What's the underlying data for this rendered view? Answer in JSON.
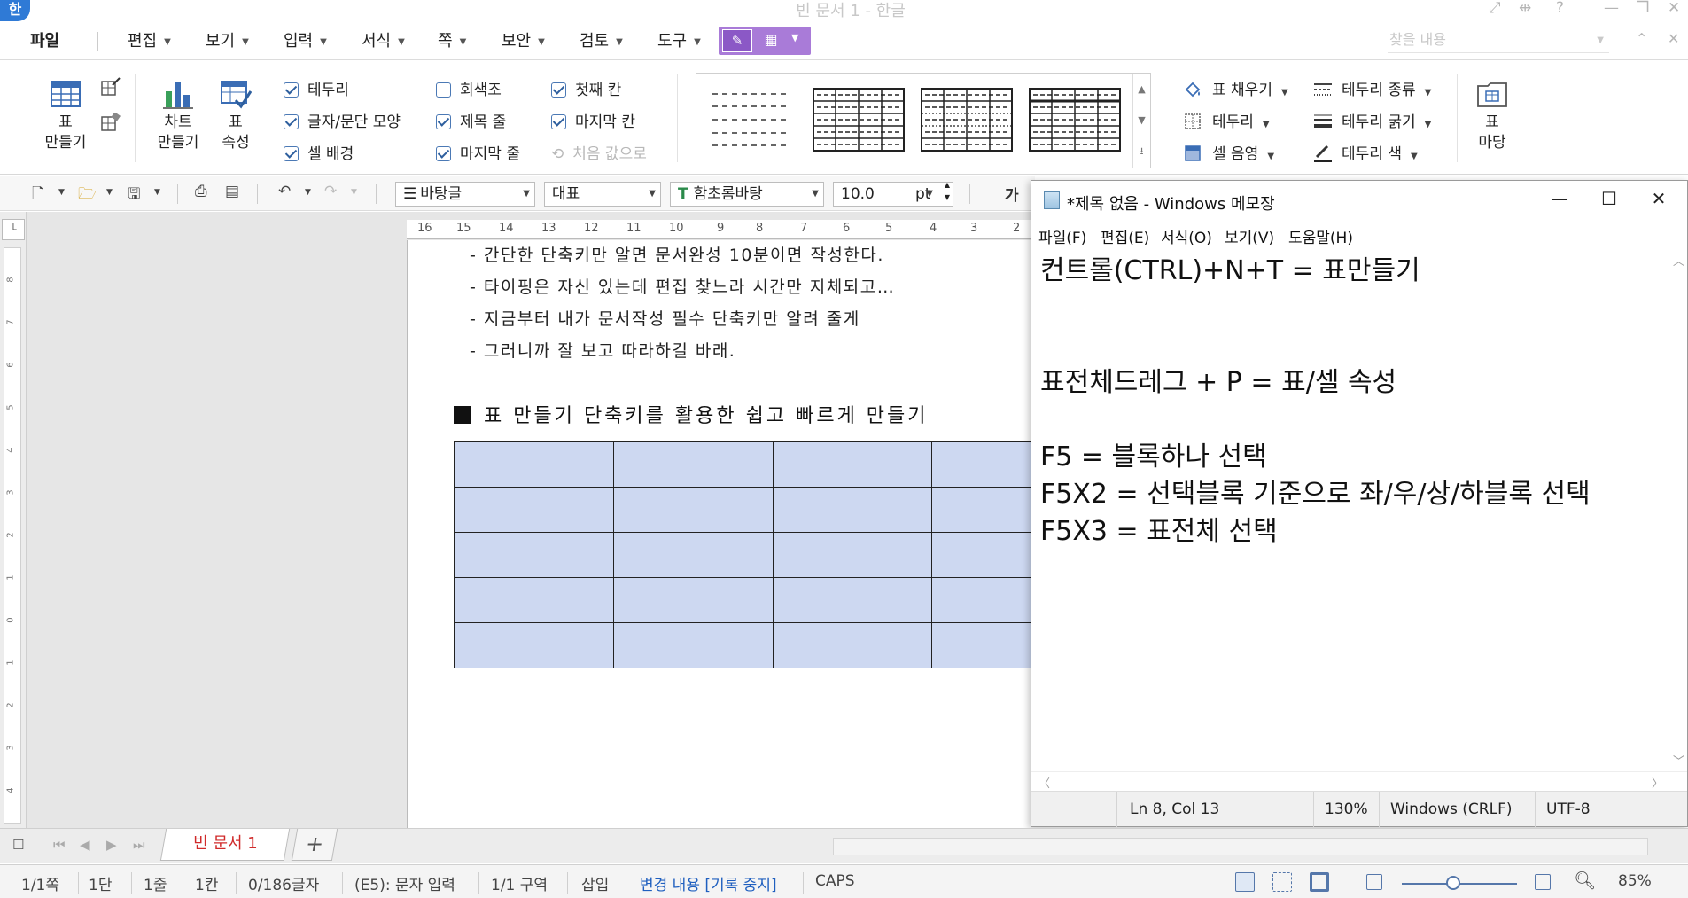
{
  "app": {
    "logo": "한",
    "window_title": "빈 문서 1 - 한글"
  },
  "menu": {
    "items": [
      "파일",
      "편집",
      "보기",
      "입력",
      "서식",
      "쪽",
      "보안",
      "검토",
      "도구"
    ],
    "find_placeholder": "찾을 내용"
  },
  "ribbon": {
    "make_table": "표\n만들기",
    "chart": "차트\n만들기",
    "table_props": "표\n속성",
    "checks": [
      {
        "label": "테두리",
        "checked": true
      },
      {
        "label": "글자/문단 모양",
        "checked": true
      },
      {
        "label": "셀 배경",
        "checked": true
      },
      {
        "label": "회색조",
        "checked": false
      },
      {
        "label": "제목 줄",
        "checked": true
      },
      {
        "label": "마지막 줄",
        "checked": true
      },
      {
        "label": "첫째 칸",
        "checked": true
      },
      {
        "label": "마지막 칸",
        "checked": true
      },
      {
        "label": "처음 값으로",
        "checked": false,
        "disabled": true
      }
    ],
    "fill": "표 채우기",
    "border": "테두리",
    "cell_shade": "셀 음영",
    "border_type": "테두리 종류",
    "border_weight": "테두리 굵기",
    "border_color": "테두리 색",
    "table_madang": "표\n마당"
  },
  "toolbar": {
    "style_combo": "바탕글",
    "lang_combo": "대표",
    "font_combo": "함초롬바탕",
    "size_value": "10.0",
    "size_unit": "pt",
    "font_preview": "가"
  },
  "ruler_marks": [
    "16",
    "15",
    "14",
    "13",
    "12",
    "11",
    "10",
    "9",
    "8",
    "7",
    "6",
    "5",
    "4",
    "3",
    "2"
  ],
  "vruler_marks": [
    "8",
    "7",
    "6",
    "5",
    "4",
    "3",
    "2",
    "1",
    "0",
    "1",
    "2",
    "3",
    "4"
  ],
  "document": {
    "lines": [
      "- 간단한 단축키만 알면 문서완성 10분이면 작성한다.",
      "- 타이핑은 자신 있는데 편집 찾느라 시간만 지체되고…",
      "- 지금부터 내가 문서작성 필수 단축키만 알려 줄게",
      "- 그러니까 잘 보고 따라하길 바래."
    ],
    "heading": "표 만들기 단축키를 활용한 쉽고 빠르게 만들기",
    "table": {
      "rows": 5,
      "cols": 4
    }
  },
  "notepad": {
    "title": "*제목 없음 - Windows 메모장",
    "menu": [
      "파일(F)",
      "편집(E)",
      "서식(O)",
      "보기(V)",
      "도움말(H)"
    ],
    "lines": [
      "컨트롤(CTRL)+N+T = 표만들기",
      "",
      "",
      "표전체드레그 + P = 표/셀 속성",
      "",
      "F5 = 블록하나 선택",
      "F5X2 = 선택블록 기준으로 좌/우/상/하블록 선택",
      "F5X3 = 표전체 선택"
    ],
    "status": {
      "position": "Ln 8, Col 13",
      "zoom": "130%",
      "eol": "Windows (CRLF)",
      "encoding": "UTF-8"
    }
  },
  "tabs": {
    "doc_tab": "빈 문서 1",
    "add": "+"
  },
  "statusbar": {
    "page": "1/1쪽",
    "column": "1단",
    "line": "1줄",
    "col": "1칸",
    "chars": "0/186글자",
    "mode": "(E5): 문자 입력",
    "section": "1/1 구역",
    "insert": "삽입",
    "track": "변경 내용 [기록 중지]",
    "caps": "CAPS",
    "zoom": "85%"
  },
  "colors": {
    "table_cell": "#cdd8f1",
    "view_toggle": "#a97bd8",
    "tab_text": "#d02a2a"
  }
}
